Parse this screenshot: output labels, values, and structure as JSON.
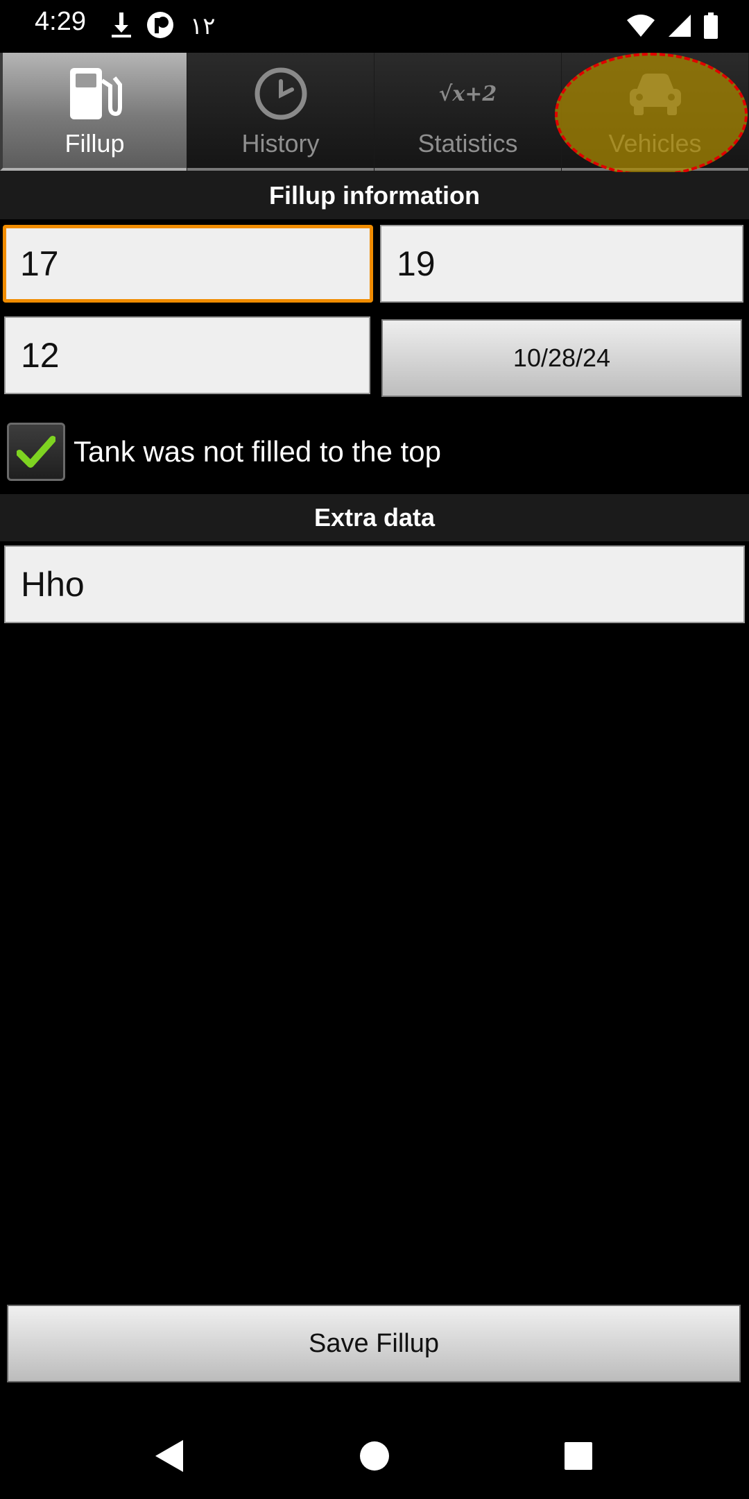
{
  "status_bar": {
    "time": "4:29",
    "extra_text": "١٢",
    "icons": [
      "download-icon",
      "app-notification-icon",
      "wifi-icon",
      "signal-icon",
      "battery-icon"
    ]
  },
  "tabs": [
    {
      "label": "Fillup",
      "icon": "fuel-pump-icon",
      "active": true
    },
    {
      "label": "History",
      "icon": "clock-icon",
      "active": false
    },
    {
      "label": "Statistics",
      "icon": "formula-icon",
      "icon_text": "√x+2",
      "active": false
    },
    {
      "label": "Vehicles",
      "icon": "car-icon",
      "active": false
    }
  ],
  "fillup_section": {
    "title": "Fillup information",
    "field_1": "17",
    "field_2": "19",
    "field_3": "12",
    "date": "10/28/24",
    "checkbox_label": "Tank was not filled to the top",
    "checkbox_checked": true
  },
  "extra_section": {
    "title": "Extra data",
    "field": "Hho"
  },
  "save_button": {
    "label": "Save Fillup"
  },
  "nav_bar": {
    "icons": [
      "back-icon",
      "home-icon",
      "recents-icon"
    ]
  },
  "colors": {
    "focus": "#f08c00",
    "highlight": "#af8c00",
    "highlight_border": "#e00000",
    "check": "#7ed321"
  }
}
